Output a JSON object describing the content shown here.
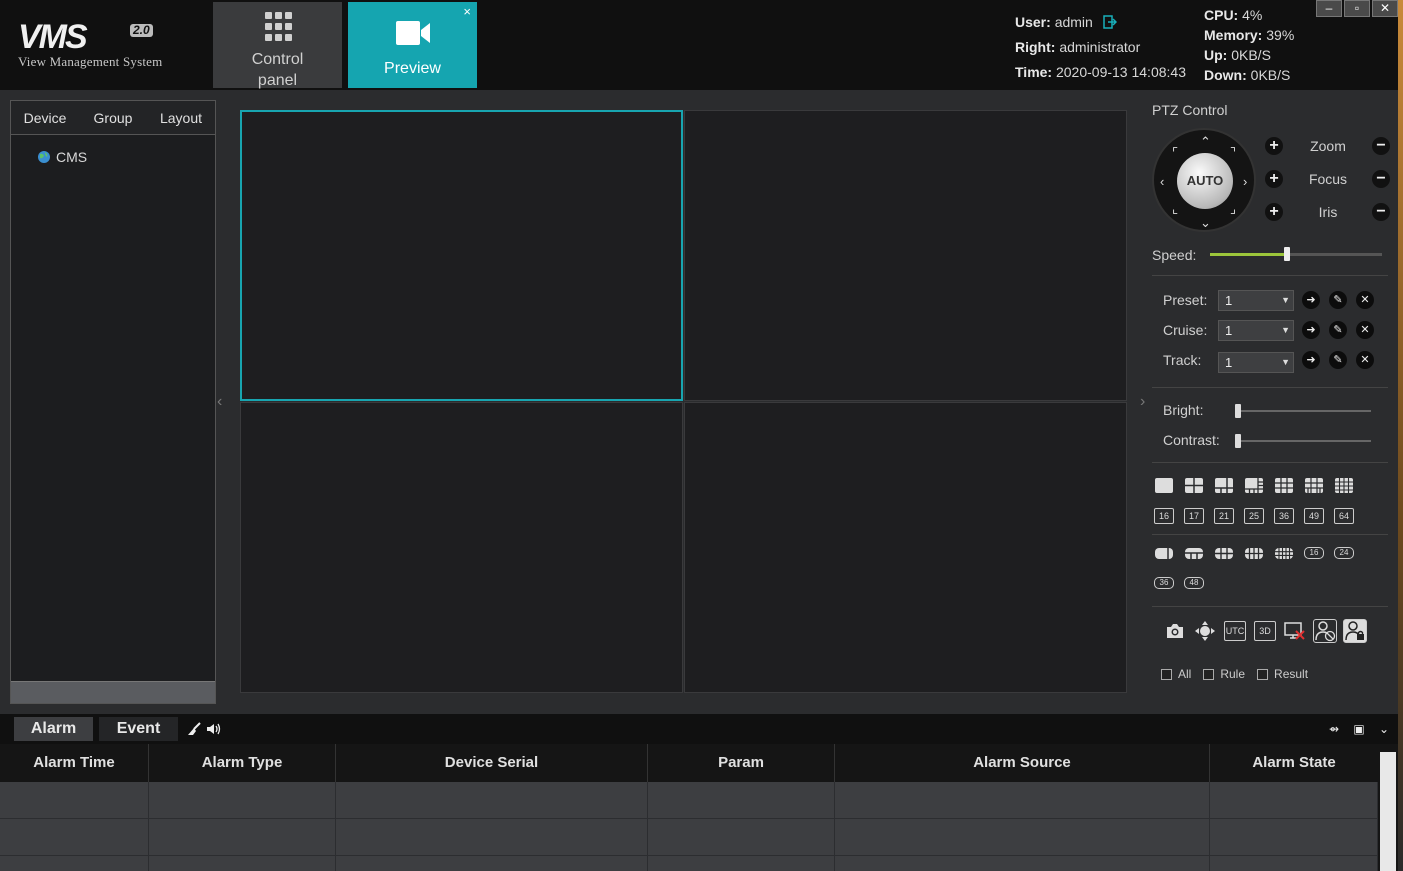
{
  "app": {
    "logo_main": "VMS",
    "logo_version": "2.0",
    "logo_subtitle": "View Management System"
  },
  "nav": {
    "control_panel_label": "Control panel",
    "preview_label": "Preview",
    "close_symbol": "×"
  },
  "user": {
    "user_key": "User:",
    "user_value": "admin",
    "right_key": "Right:",
    "right_value": "administrator",
    "time_key": "Time:",
    "time_value": "2020-09-13 14:08:43"
  },
  "system": {
    "cpu_key": "CPU:",
    "cpu_value": "4%",
    "memory_key": "Memory:",
    "memory_value": "39%",
    "up_key": "Up:",
    "up_value": "0KB/S",
    "down_key": "Down:",
    "down_value": "0KB/S"
  },
  "window_controls": {
    "minimize": "–",
    "maximize": "▫",
    "close": "✕"
  },
  "left_panel": {
    "tabs": [
      "Device",
      "Group",
      "Layout"
    ],
    "tree_root": "CMS"
  },
  "ptz": {
    "title": "PTZ Control",
    "auto_label": "AUTO",
    "zoom": "Zoom",
    "focus": "Focus",
    "iris": "Iris",
    "speed_label": "Speed:",
    "speed_level": 0.45,
    "preset_label": "Preset:",
    "preset_value": "1",
    "cruise_label": "Cruise:",
    "cruise_value": "1",
    "track_label": "Track:",
    "track_value": "1",
    "bright_label": "Bright:",
    "bright_level": 0.0,
    "contrast_label": "Contrast:",
    "contrast_level": 0.0,
    "layout_numbers_row1": [
      "16",
      "17",
      "21",
      "25",
      "36",
      "49",
      "64"
    ],
    "layout_numbers_row2": [
      "16",
      "24"
    ],
    "layout_numbers_row3": [
      "36",
      "48"
    ],
    "tool_utc": "UTC",
    "tool_3d": "3D",
    "check_all": "All",
    "check_rule": "Rule",
    "check_result": "Result"
  },
  "bottom": {
    "tab_alarm": "Alarm",
    "tab_event": "Event",
    "columns": [
      "Alarm Time",
      "Alarm Type",
      "Device Serial",
      "Param",
      "Alarm Source",
      "Alarm State"
    ]
  },
  "colors": {
    "accent": "#15a5b0",
    "speed_fill": "#9cc63b",
    "background": "#2b2c2e",
    "header": "#101010"
  }
}
